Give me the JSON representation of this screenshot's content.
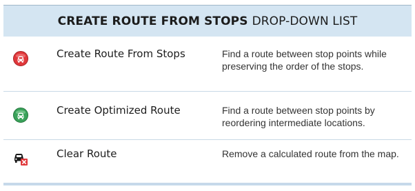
{
  "header": {
    "title_bold": "CREATE ROUTE FROM STOPS",
    "title_rest": "DROP-DOWN LIST"
  },
  "rows": [
    {
      "icon": "create-route-icon",
      "icon_color": "#e0383b",
      "name": "Create Route From Stops",
      "description": "Find a route between stop points while preserving the order of the stops."
    },
    {
      "icon": "optimized-route-icon",
      "icon_color": "#3aa25a",
      "name": "Create Optimized Route",
      "description": "Find a route between stop points by reordering intermediate locations."
    },
    {
      "icon": "clear-route-icon",
      "icon_color": "#e0383b",
      "name": "Clear Route",
      "description": "Remove a calculated route from the map."
    }
  ],
  "colors": {
    "header_bg": "#d4e5f2",
    "divider": "#c9d9e6"
  }
}
